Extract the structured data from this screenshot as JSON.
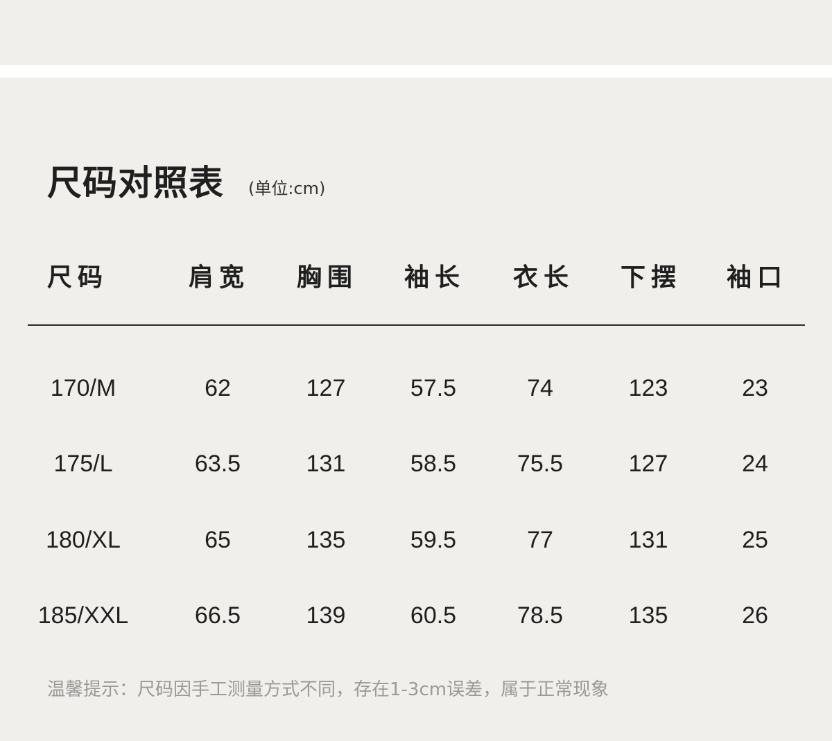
{
  "title": "尺码对照表",
  "unit": "(单位:cm)",
  "table": {
    "headers": [
      "尺码",
      "肩宽",
      "胸围",
      "袖长",
      "衣长",
      "下摆",
      "袖口"
    ],
    "rows": [
      [
        "170/M",
        "62",
        "127",
        "57.5",
        "74",
        "123",
        "23"
      ],
      [
        "175/L",
        "63.5",
        "131",
        "58.5",
        "75.5",
        "127",
        "24"
      ],
      [
        "180/XL",
        "65",
        "135",
        "59.5",
        "77",
        "131",
        "25"
      ],
      [
        "185/XXL",
        "66.5",
        "139",
        "60.5",
        "78.5",
        "135",
        "26"
      ]
    ]
  },
  "note": "温馨提示：尺码因手工测量方式不同，存在1-3cm误差，属于正常现象"
}
